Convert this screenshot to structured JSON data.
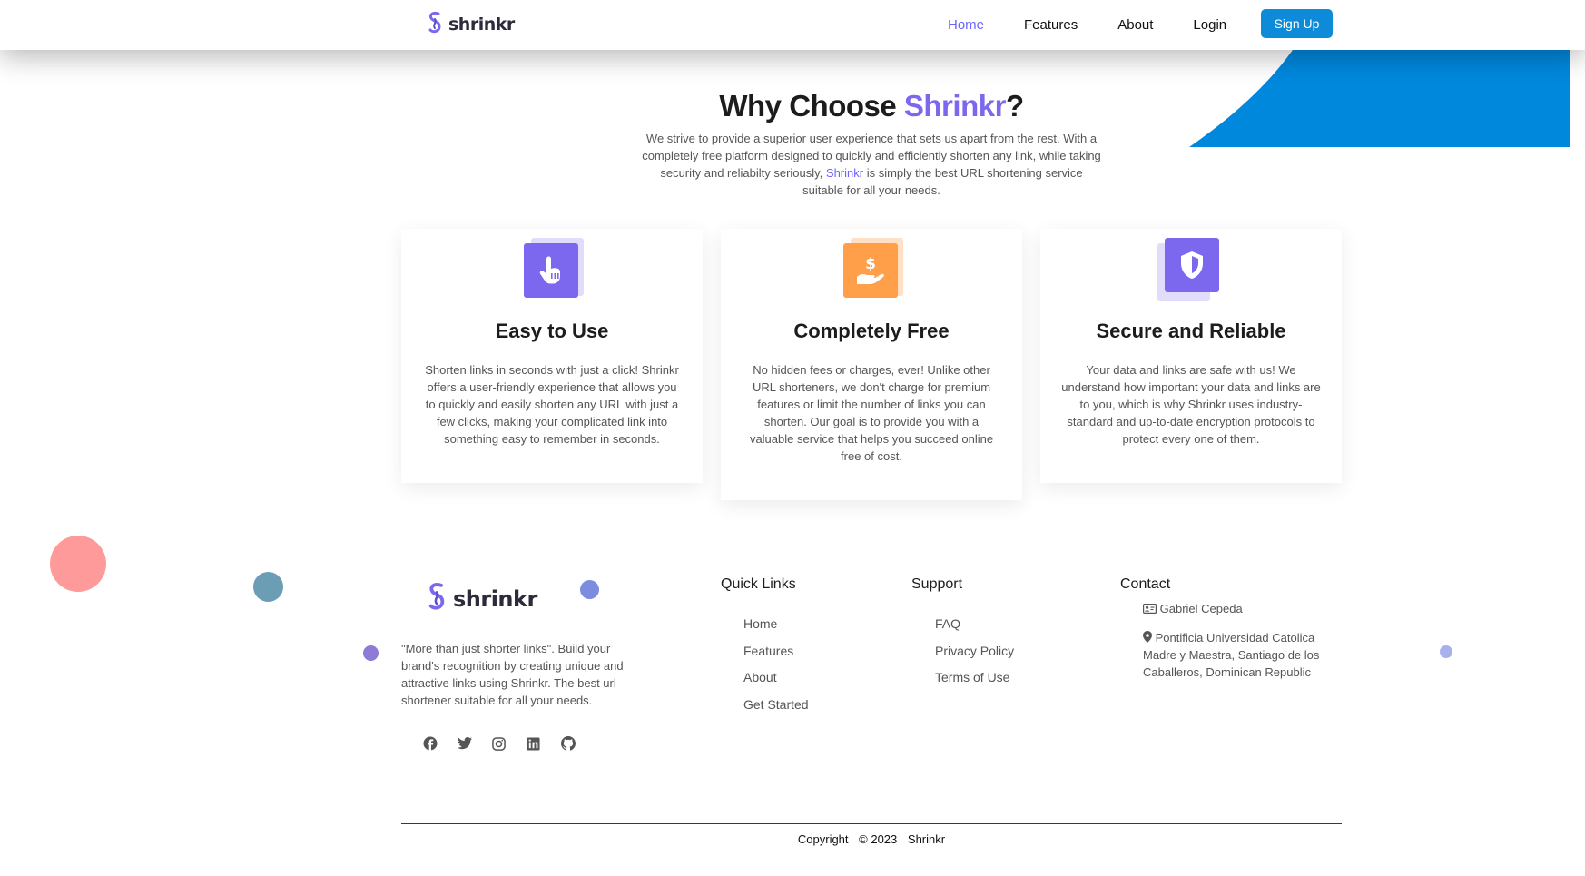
{
  "nav": {
    "brand": "shrinkr",
    "links": [
      "Home",
      "Features",
      "About",
      "Login"
    ],
    "active_link": "Home",
    "signup_label": "Sign Up"
  },
  "hero": {
    "title_prefix": "Why Choose ",
    "title_accent": "Shrinkr",
    "title_suffix": "?",
    "text_before": "We strive to provide a superior user experience that sets us apart from the rest. With a completely free platform designed to quickly and efficiently shorten any link, while taking security and reliabilty seriously, ",
    "text_accent": "Shrinkr",
    "text_after": " is simply the best URL shortening service suitable for all your needs."
  },
  "features": [
    {
      "icon": "pointer-hand-icon",
      "title": "Easy to Use",
      "text": "Shorten links in seconds with just a click! Shrinkr offers a user-friendly experience that allows you to quickly and easily shorten any URL with just a few clicks, making your complicated link into something easy to remember in seconds."
    },
    {
      "icon": "hand-dollar-icon",
      "title": "Completely Free",
      "text": "No hidden fees or charges, ever! Unlike other URL shorteners, we don't charge for premium features or limit the number of links you can shorten. Our goal is to provide you with a valuable service that helps you succeed online free of cost."
    },
    {
      "icon": "shield-icon",
      "title": "Secure and Reliable",
      "text": "Your data and links are safe with us! We understand how important your data and links are to you, which is why Shrinkr uses industry-standard and up-to-date encryption protocols to protect every one of them."
    }
  ],
  "footer": {
    "brand": "shrinkr",
    "about": "\"More than just shorter links\". Build your brand's recognition by creating unique and attractive links using Shrinkr. The best url shortener suitable for all your needs.",
    "socials": [
      "facebook-icon",
      "twitter-icon",
      "instagram-icon",
      "linkedin-icon",
      "github-icon"
    ],
    "quick_links": {
      "heading": "Quick Links",
      "items": [
        "Home",
        "Features",
        "About",
        "Get Started"
      ]
    },
    "support": {
      "heading": "Support",
      "items": [
        "FAQ",
        "Privacy Policy",
        "Terms of Use"
      ]
    },
    "contact": {
      "heading": "Contact",
      "name": "Gabriel Cepeda",
      "address": "Pontificia Universidad Catolica Madre y Maestra, Santiago de los Caballeros, Dominican Republic"
    },
    "copyright": {
      "label": "Copyright",
      "symbol_year": "© 2023",
      "brand": "Shrinkr"
    }
  },
  "colors": {
    "accent": "#7b68ee",
    "signup": "#0d8bd9",
    "feature_easy": "#7b68ee",
    "feature_free": "#ff9f4a",
    "feature_secure": "#7b68ee"
  }
}
